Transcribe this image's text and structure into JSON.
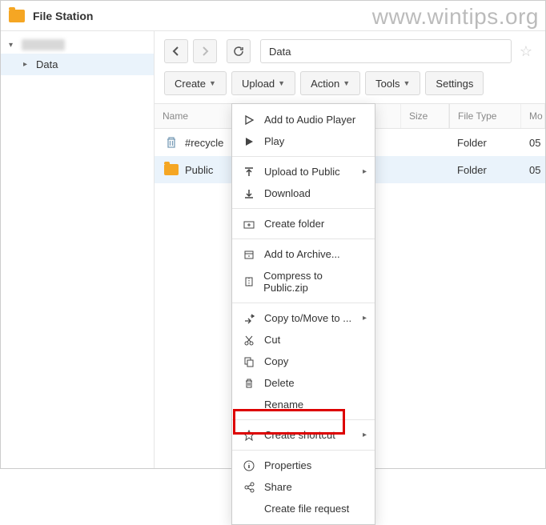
{
  "app": {
    "title": "File Station"
  },
  "watermark": "www.wintips.org",
  "sidebar": {
    "root_expanded": true,
    "items": [
      {
        "label": "Data"
      }
    ]
  },
  "path": "Data",
  "toolbar": {
    "create": "Create",
    "upload": "Upload",
    "action": "Action",
    "tools": "Tools",
    "settings": "Settings"
  },
  "columns": {
    "name": "Name",
    "size": "Size",
    "type": "File Type",
    "modified": "Mo"
  },
  "rows": [
    {
      "name": "#recycle",
      "icon": "trash",
      "type": "Folder",
      "modified": "05"
    },
    {
      "name": "Public",
      "icon": "folder",
      "type": "Folder",
      "modified": "05"
    }
  ],
  "menu": {
    "add_audio": "Add to Audio Player",
    "play": "Play",
    "upload_to": "Upload to Public",
    "download": "Download",
    "create_folder": "Create folder",
    "add_archive": "Add to Archive...",
    "compress": "Compress to Public.zip",
    "copy_move": "Copy to/Move to ...",
    "cut": "Cut",
    "copy": "Copy",
    "delete": "Delete",
    "rename": "Rename",
    "shortcut": "Create shortcut",
    "properties": "Properties",
    "share": "Share",
    "file_request": "Create file request"
  }
}
